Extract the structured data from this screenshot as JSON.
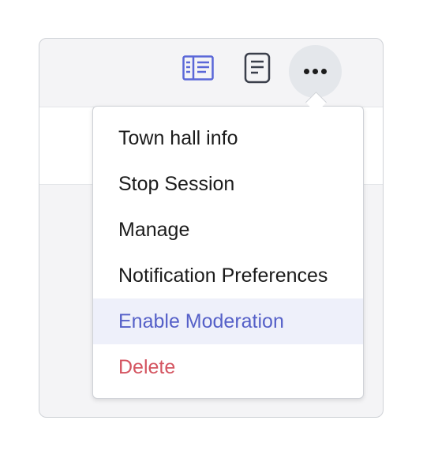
{
  "toolbar": {
    "info_icon": "sidebar-info-icon",
    "notes_icon": "notes-icon",
    "more_icon": "more-dots-icon"
  },
  "menu": {
    "items": [
      {
        "label": "Town hall info",
        "color": "#1b1b1b"
      },
      {
        "label": "Stop Session",
        "color": "#1b1b1b"
      },
      {
        "label": "Manage",
        "color": "#1b1b1b"
      },
      {
        "label": "Notification Preferences",
        "color": "#1b1b1b"
      },
      {
        "label": "Enable Moderation",
        "color": "#5560c8",
        "highlighted": true
      },
      {
        "label": "Delete",
        "color": "#d45561"
      }
    ]
  },
  "colors": {
    "accent": "#5560c8",
    "danger": "#d45561",
    "highlight_bg": "#eef0fa"
  }
}
